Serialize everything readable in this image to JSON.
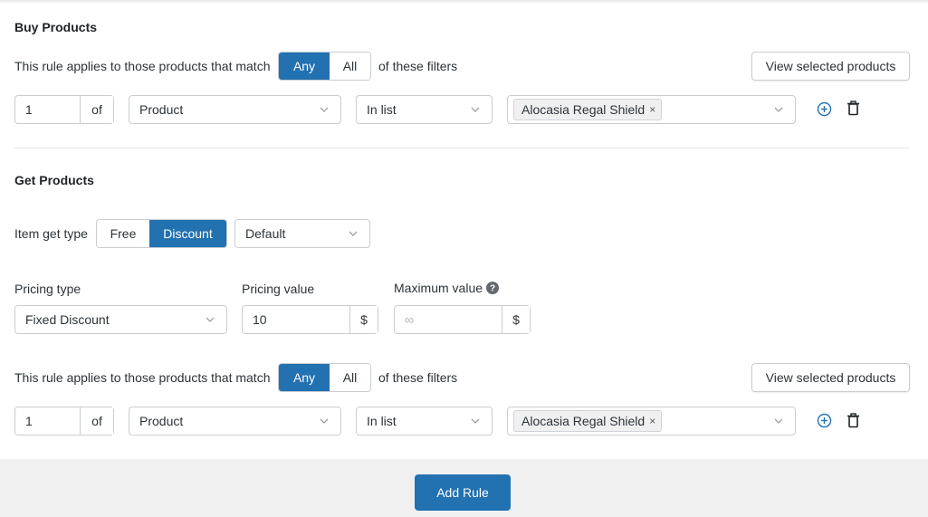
{
  "buy": {
    "heading": "Buy Products",
    "match_prefix": "This rule applies to those products that match",
    "match_any": "Any",
    "match_all": "All",
    "match_suffix": "of these filters",
    "view_selected": "View selected products",
    "qty": "1",
    "of": "of",
    "filter_type": "Product",
    "operator": "In list",
    "selected_tag": "Alocasia Regal Shield",
    "tag_remove": "×"
  },
  "get": {
    "heading": "Get Products",
    "item_get_type_label": "Item get type",
    "type_free": "Free",
    "type_discount": "Discount",
    "mode": "Default",
    "pricing_type_label": "Pricing type",
    "pricing_type": "Fixed Discount",
    "pricing_value_label": "Pricing value",
    "pricing_value": "10",
    "currency": "$",
    "max_value_label": "Maximum value",
    "max_value_placeholder": "∞",
    "max_currency": "$",
    "match_prefix": "This rule applies to those products that match",
    "match_any": "Any",
    "match_all": "All",
    "match_suffix": "of these filters",
    "view_selected": "View selected products",
    "qty": "1",
    "of": "of",
    "filter_type": "Product",
    "operator": "In list",
    "selected_tag": "Alocasia Regal Shield",
    "tag_remove": "×"
  },
  "footer": {
    "add_rule": "Add Rule"
  },
  "icons": {
    "add": "plus-circle-icon",
    "delete": "trash-icon",
    "help": "question-circle-icon",
    "chevron": "chevron-down-icon"
  },
  "colors": {
    "primary": "#2271b1",
    "border": "#c9cdd2",
    "footer_bg": "#f0f0f1"
  }
}
